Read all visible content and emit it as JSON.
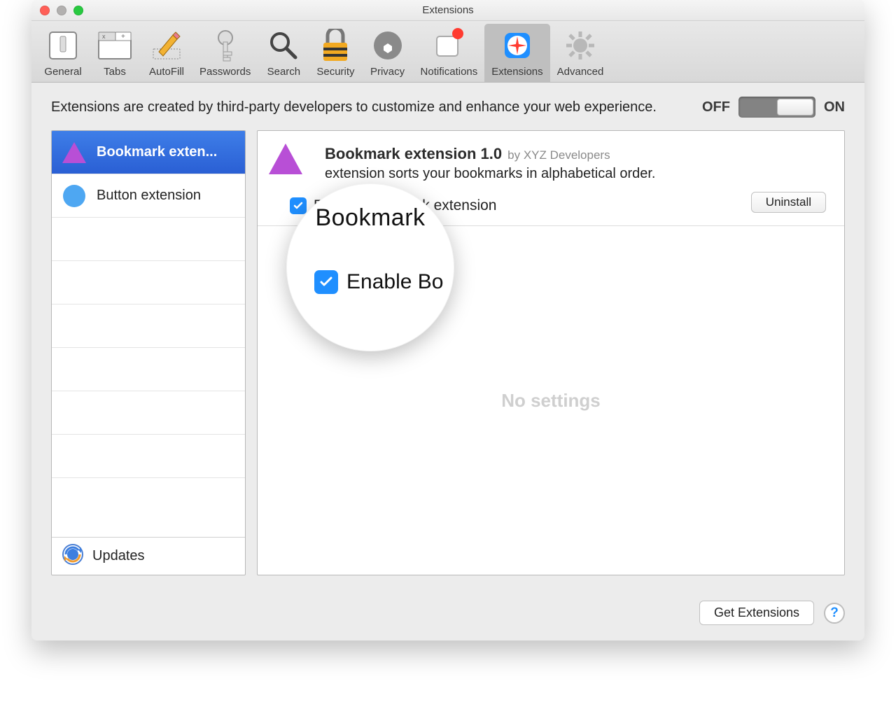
{
  "window": {
    "title": "Extensions"
  },
  "toolbar": {
    "items": [
      {
        "label": "General"
      },
      {
        "label": "Tabs"
      },
      {
        "label": "AutoFill"
      },
      {
        "label": "Passwords"
      },
      {
        "label": "Search"
      },
      {
        "label": "Security"
      },
      {
        "label": "Privacy"
      },
      {
        "label": "Notifications"
      },
      {
        "label": "Extensions"
      },
      {
        "label": "Advanced"
      }
    ]
  },
  "intro": "Extensions are created by third-party developers to customize and enhance your web experience.",
  "toggle": {
    "off": "OFF",
    "on": "ON",
    "state": "on"
  },
  "sidebar": {
    "items": [
      {
        "label": "Bookmark exten..."
      },
      {
        "label": "Button extension"
      }
    ],
    "updates": "Updates"
  },
  "detail": {
    "title": "Bookmark extension 1.0",
    "by_prefix": "by",
    "author": "XYZ Developers",
    "description": "extension sorts your bookmarks in alphabetical order.",
    "enable_label": "Enable Bookmark extension",
    "uninstall": "Uninstall",
    "no_settings": "No settings"
  },
  "magnifier": {
    "top_text": "Bookmark",
    "label": "Enable Bo"
  },
  "footer": {
    "get_extensions": "Get Extensions",
    "help": "?"
  }
}
